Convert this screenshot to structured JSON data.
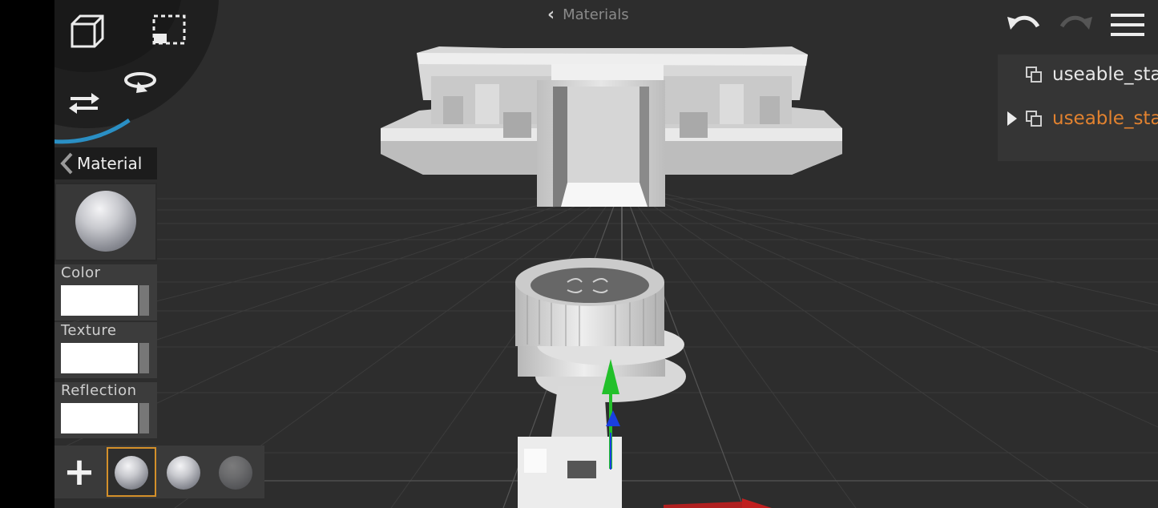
{
  "breadcrumb": {
    "label": "Materials"
  },
  "outliner": {
    "items": [
      {
        "label": "useable_sta",
        "color": "#e8e8e8",
        "expandable": false
      },
      {
        "label": "useable_sta",
        "color": "#e2822f",
        "expandable": true
      }
    ]
  },
  "material_panel": {
    "title": "Material",
    "properties": [
      {
        "label": "Color",
        "value": "#ffffff"
      },
      {
        "label": "Texture",
        "value": "#ffffff"
      },
      {
        "label": "Reflection",
        "value": "#ffffff"
      }
    ]
  },
  "material_bar": {
    "add_label": "+",
    "selected_index": 0,
    "slot_count": 3
  },
  "colors": {
    "viewport_bg": "#2d2d2d",
    "accent_selected": "#d4902a",
    "gizmo_x": "#c02020",
    "gizmo_y": "#22c02a",
    "gizmo_z": "#1a3fe0",
    "dial_arc": "#2a8fc4"
  },
  "tool_icons": [
    "cube-icon",
    "selection-marquee-icon",
    "rotate-icon",
    "swap-arrows-icon"
  ],
  "toolbar_icons": [
    "undo-icon",
    "redo-icon",
    "menu-icon"
  ]
}
